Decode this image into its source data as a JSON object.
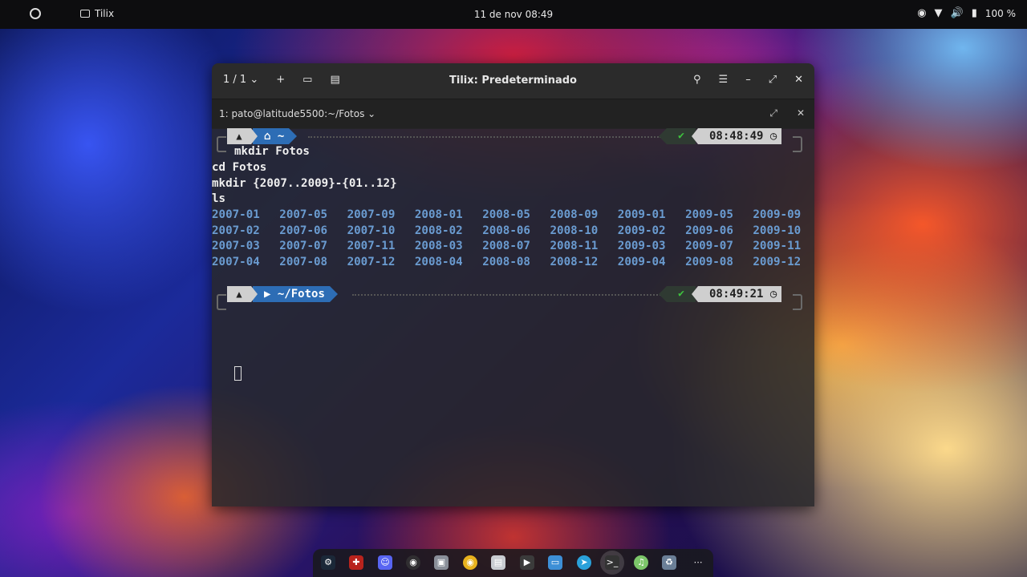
{
  "topbar": {
    "app_name": "Tilix",
    "clock": "11 de nov  08:49",
    "battery": "100 %"
  },
  "window": {
    "tab_counter": "1 / 1",
    "title": "Tilix: Predeterminado",
    "session_title": "1: pato@latitude5500:~/Fotos"
  },
  "terminal": {
    "prompt1": {
      "path": "~",
      "time": "08:48:49"
    },
    "commands": [
      "mkdir Fotos",
      "cd Fotos",
      "mkdir {2007..2009}-{01..12}",
      "ls"
    ],
    "ls_rows": [
      [
        "2007-01",
        "2007-05",
        "2007-09",
        "2008-01",
        "2008-05",
        "2008-09",
        "2009-01",
        "2009-05",
        "2009-09"
      ],
      [
        "2007-02",
        "2007-06",
        "2007-10",
        "2008-02",
        "2008-06",
        "2008-10",
        "2009-02",
        "2009-06",
        "2009-10"
      ],
      [
        "2007-03",
        "2007-07",
        "2007-11",
        "2008-03",
        "2008-07",
        "2008-11",
        "2009-03",
        "2009-07",
        "2009-11"
      ],
      [
        "2007-04",
        "2007-08",
        "2007-12",
        "2008-04",
        "2008-08",
        "2008-12",
        "2009-04",
        "2009-08",
        "2009-12"
      ]
    ],
    "prompt2": {
      "path": "~/Fotos",
      "time": "08:49:21"
    }
  },
  "dock": {
    "items": [
      "steam-icon",
      "dota-icon",
      "discord-icon",
      "obs-icon",
      "files-icon",
      "chrome-icon",
      "software-icon",
      "video-icon",
      "folder-icon",
      "telegram-icon",
      "terminal-icon",
      "spotify-icon",
      "trash-icon",
      "app-grid-icon"
    ]
  }
}
